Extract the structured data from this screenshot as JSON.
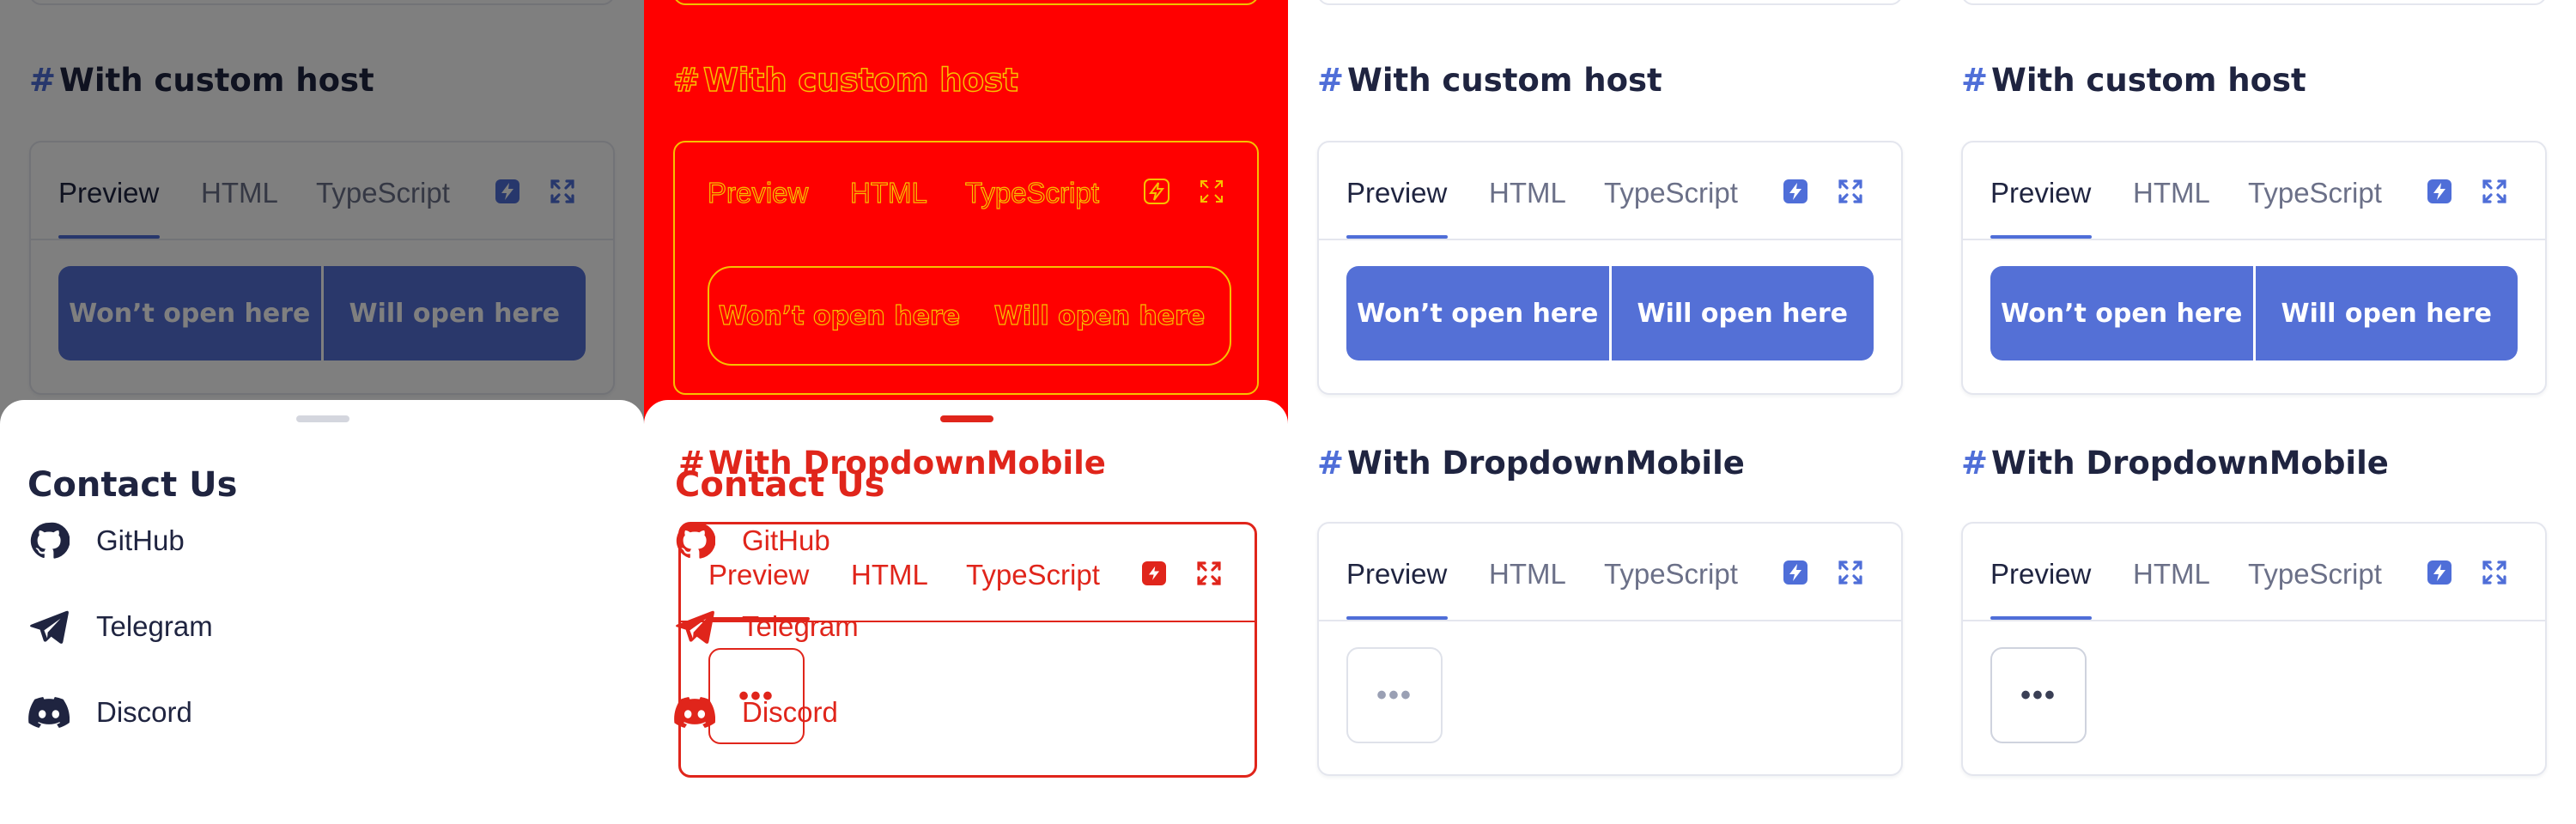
{
  "sections": {
    "custom_host": {
      "title": "With custom host",
      "hash": "#",
      "tabs": [
        "Preview",
        "HTML",
        "TypeScript"
      ],
      "buttons": [
        "Won’t open here",
        "Will open here"
      ]
    },
    "dropdown_mobile": {
      "title": "With DropdownMobile",
      "hash": "#",
      "tabs": [
        "Preview",
        "HTML",
        "TypeScript"
      ],
      "more_label": "•••"
    }
  },
  "toolbar_icons": [
    "stackblitz-icon",
    "fullscreen-icon"
  ],
  "sheet": {
    "title": "Contact Us",
    "items": [
      {
        "label": "GitHub",
        "icon": "github-icon"
      },
      {
        "label": "Telegram",
        "icon": "telegram-icon"
      },
      {
        "label": "Discord",
        "icon": "discord-icon"
      }
    ]
  },
  "colors": {
    "accent": "#5470d6",
    "text": "#1f2440",
    "muted": "#6b7088",
    "border": "#e4e6ee",
    "debug_red": "#ff0000",
    "debug_yellow": "#f7c000",
    "debug_outline": "#e0251b"
  }
}
